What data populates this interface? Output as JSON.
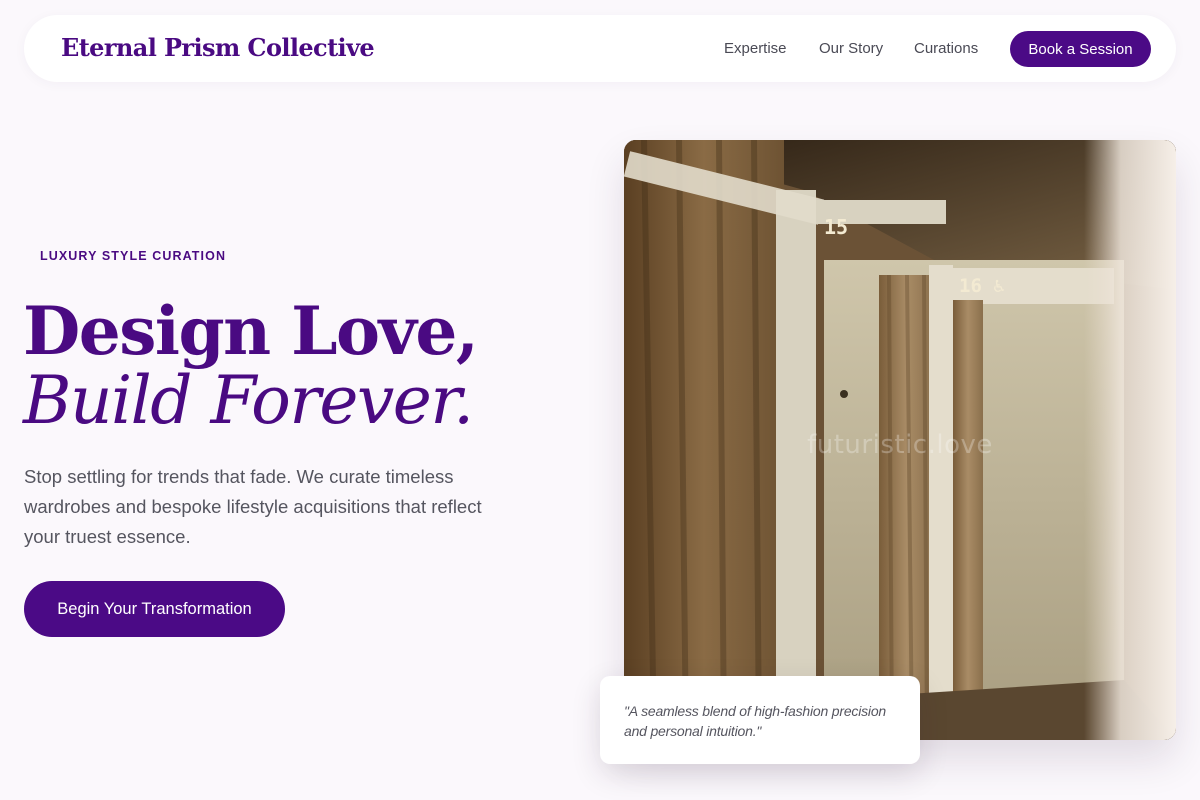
{
  "header": {
    "brand": "Eternal Prism Collective",
    "nav": [
      {
        "label": "Expertise"
      },
      {
        "label": "Our Story"
      },
      {
        "label": "Curations"
      }
    ],
    "cta_label": "Book a Session"
  },
  "hero": {
    "eyebrow": "LUXURY STYLE CURATION",
    "headline_line1": "Design Love,",
    "headline_line2": "Build Forever.",
    "description": "Stop settling for trends that fade. We curate timeless wardrobes and bespoke lifestyle acquisitions that reflect your truest essence.",
    "cta_label": "Begin Your Transformation"
  },
  "image": {
    "watermark": "futuristic.love",
    "sign_15": "15",
    "sign_16": "16 ♿"
  },
  "quote": {
    "text": "\"A seamless blend of high-fashion precision and personal intuition.\""
  },
  "colors": {
    "accent": "#4b0a86",
    "background": "#fbf8fc"
  }
}
